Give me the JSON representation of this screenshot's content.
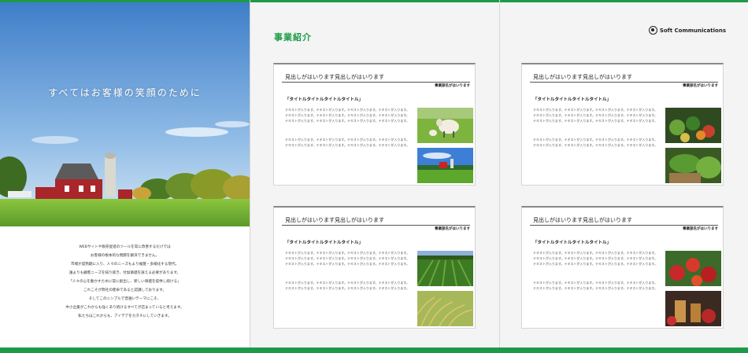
{
  "page1": {
    "hero_title": "すべてはお客様の笑顔のために",
    "intro_lines": [
      "WEBサイトや販売促進のツールを常に改善するだけでは",
      "お客様の根本的な問題を解決できません。",
      "市場が成熟期に入り、人々のニーズもより複雑・多様化する現代。",
      "誰よりも顧客ニーズを知り抜き、付加価値を訴える必要があります。",
      "「人々の心を動かすために常に創出し、新しい価値を提供し続ける」",
      "これこそが弊社の使命であると認識しております。",
      "そしてこのシンプルで普遍いテーマにこそ、",
      "中小企業がこれからも強くあり続けるすべてが詰まっていると考えます。",
      "私たちはこれからも、アイデアをカタチにしていきます。"
    ]
  },
  "page2": {
    "section_title": "事業紹介"
  },
  "page3": {
    "logo_text": "Soft Communications"
  },
  "cards": [
    {
      "heading": "見出しがはいります見出しがはいります",
      "dept": "事業部名がはいります",
      "subtitle": "「タイトルタイトルタイトルタイトル」",
      "body1": "テキストが入ります。テキストが入ります。テキストが入ります。テキストが入ります。テキストが入ります。テキストが入ります。テキストが入ります。テキストが入ります。テキストが入ります。テキストが入ります。テキストが入ります。テキストが入ります。",
      "body2": "テキストが入ります。テキストが入ります。テキストが入ります。テキストが入ります。テキストが入ります。テキストが入ります。テキストが入ります。テキストが入ります。",
      "images": [
        "sheep-photo",
        "farm-field-photo"
      ]
    },
    {
      "heading": "見出しがはいります見出しがはいります",
      "dept": "事業部名がはいります",
      "subtitle": "「タイトルタイトルタイトルタイトル」",
      "body1": "テキストが入ります。テキストが入ります。テキストが入ります。テキストが入ります。テキストが入ります。テキストが入ります。テキストが入ります。テキストが入ります。テキストが入ります。テキストが入ります。テキストが入ります。テキストが入ります。",
      "body2": "テキストが入ります。テキストが入ります。テキストが入ります。テキストが入ります。テキストが入ります。テキストが入ります。テキストが入ります。テキストが入ります。",
      "images": [
        "vegetables-photo",
        "greens-basket-photo"
      ]
    },
    {
      "heading": "見出しがはいります見出しがはいります",
      "dept": "事業部名がはいります",
      "subtitle": "「タイトルタイトルタイトルタイトル」",
      "body1": "テキストが入ります。テキストが入ります。テキストが入ります。テキストが入ります。テキストが入ります。テキストが入ります。テキストが入ります。テキストが入ります。テキストが入ります。テキストが入ります。テキストが入ります。テキストが入ります。",
      "body2": "テキストが入ります。テキストが入ります。テキストが入ります。テキストが入ります。テキストが入ります。テキストが入ります。テキストが入ります。テキストが入ります。",
      "images": [
        "vineyard-photo",
        "rice-photo"
      ]
    },
    {
      "heading": "見出しがはいります見出しがはいります",
      "dept": "事業部名がはいります",
      "subtitle": "「タイトルタイトルタイトルタイトル」",
      "body1": "テキストが入ります。テキストが入ります。テキストが入ります。テキストが入ります。テキストが入ります。テキストが入ります。テキストが入ります。テキストが入ります。テキストが入ります。テキストが入ります。テキストが入ります。テキストが入ります。",
      "body2": "テキストが入ります。テキストが入ります。テキストが入ります。テキストが入ります。テキストが入ります。テキストが入ります。テキストが入ります。テキストが入ります。",
      "images": [
        "apples-photo",
        "juice-photo"
      ]
    }
  ],
  "colors": {
    "accent": "#1d9a48"
  }
}
